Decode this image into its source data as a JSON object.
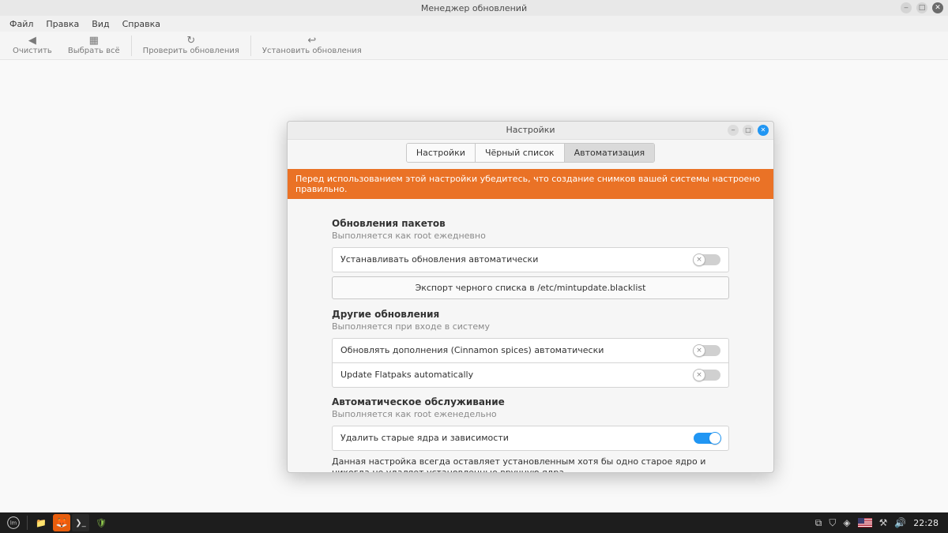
{
  "main_window": {
    "title": "Менеджер обновлений",
    "menu": {
      "file": "Файл",
      "edit": "Правка",
      "view": "Вид",
      "help": "Справка"
    },
    "toolbar": {
      "clear": "Очистить",
      "select_all": "Выбрать всё",
      "check": "Проверить обновления",
      "install": "Установить обновления"
    }
  },
  "dialog": {
    "title": "Настройки",
    "tabs": {
      "prefs": "Настройки",
      "blacklist": "Чёрный список",
      "automation": "Автоматизация"
    },
    "banner": "Перед использованием этой настройки убедитесь, что создание снимков вашей системы настроено правильно.",
    "sections": {
      "packages": {
        "title": "Обновления пакетов",
        "sub": "Выполняется как root ежедневно",
        "auto_install": "Устанавливать обновления автоматически",
        "export_btn": "Экспорт черного списка в /etc/mintupdate.blacklist"
      },
      "other": {
        "title": "Другие обновления",
        "sub": "Выполняется при входе в систему",
        "spices": "Обновлять дополнения (Cinnamon spices) автоматически",
        "flatpak": "Update Flatpaks automatically"
      },
      "maint": {
        "title": "Автоматическое обслуживание",
        "sub": "Выполняется как root еженедельно",
        "remove_kernels": "Удалить старые ядра и зависимости",
        "note": "Данная настройка всегда оставляет установленным хотя бы одно старое ядро и никогда не удаляет установленные вручную ядра."
      }
    },
    "toggles": {
      "auto_install": false,
      "spices": false,
      "flatpak": false,
      "remove_kernels": true
    }
  },
  "taskbar": {
    "clock": "22:28"
  }
}
